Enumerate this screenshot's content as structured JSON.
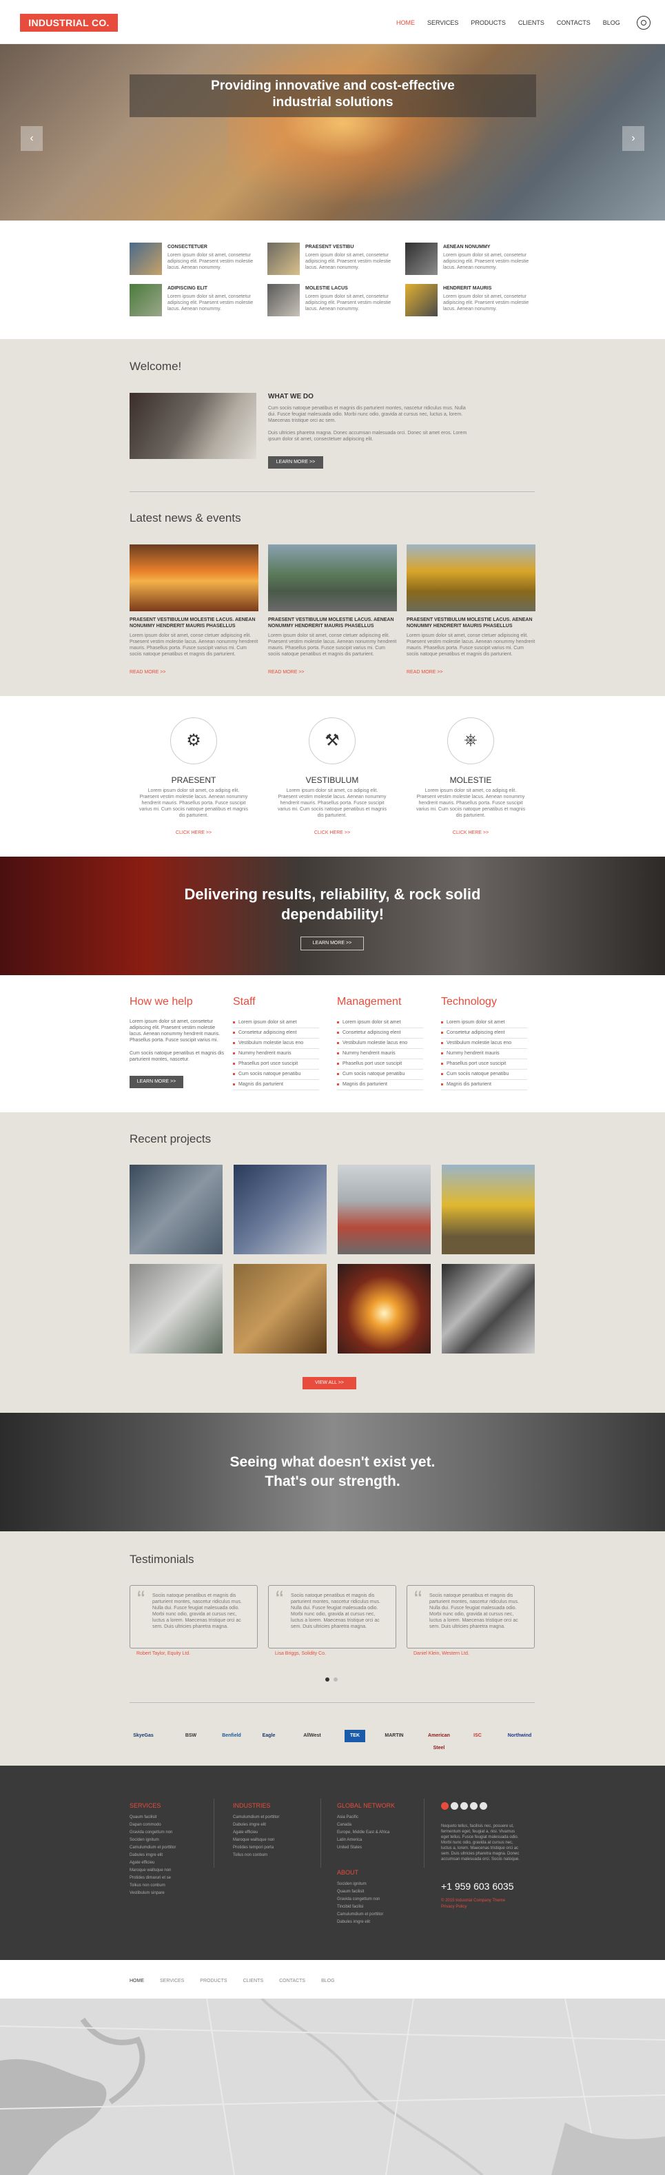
{
  "brand": {
    "logo": "INDUSTRIAL CO.",
    "accent": "#e74c3c"
  },
  "nav": {
    "items": [
      "HOME",
      "SERVICES",
      "PRODUCTS",
      "CLIENTS",
      "CONTACTS",
      "BLOG"
    ],
    "active": "HOME"
  },
  "hero": {
    "title_line1": "Providing innovative and cost-effective",
    "title_line2": "industrial solutions",
    "prev_arrow": "‹",
    "next_arrow": "›"
  },
  "features": [
    {
      "title": "CONSECTETUER",
      "text": "Lorem ipsum dolor sit amet, consetetur adipiscing elit. Praesent vestim molestie lacus. Aenean nonummy."
    },
    {
      "title": "PRAESENT VESTIBU",
      "text": "Lorem ipsum dolor sit amet, consetetur adipiscing elit. Praesent vestim molestie lacus. Aenean nonummy."
    },
    {
      "title": "AENEAN NONUMMY",
      "text": "Lorem ipsum dolor sit amet, consetetur adipiscing elit. Praesent vestim molestie lacus. Aenean nonummy."
    },
    {
      "title": "ADIPISCING ELIT",
      "text": "Lorem ipsum dolor sit amet, consetetur adipiscing elit. Praesent vestim molestie lacus. Aenean nonummy."
    },
    {
      "title": "MOLESTIE LACUS",
      "text": "Lorem ipsum dolor sit amet, consetetur adipiscing elit. Praesent vestim molestie lacus. Aenean nonummy."
    },
    {
      "title": "HENDRERIT MAURIS",
      "text": "Lorem ipsum dolor sit amet, consetetur adipiscing elit. Praesent vestim molestie lacus. Aenean nonummy."
    }
  ],
  "welcome": {
    "title": "Welcome!",
    "what_we_do": "WHAT WE DO",
    "para1": "Cum sociis natoque penatibus et magnis dis parturient montes, nascetur ridiculus mus. Nulla dui. Fusce feugiat malesuada odio. Morbi nunc odio, gravida at cursus nec, luctus a, lorem. Maecenas tristique orci ac sem.",
    "para2": "Duis ultricies pharetra magna. Donec accumsan malesuada orci. Donec sit amet eros. Lorem ipsum dolor sit amet, consectetuer adipiscing elit.",
    "button": "LEARN MORE >>"
  },
  "news": {
    "title": "Latest news & events",
    "items": [
      {
        "heading": "PRAESENT VESTIBULUM MOLESTIE LACUS. AENEAN NONUMMY HENDRERIT MAURIS PHASELLUS",
        "text": "Lorem ipsum dolor sit amet, conse ctetuer adipiscing elit. Praesent vestim molestie lacus. Aenean nonummy hendrerit mauris. Phasellus porta. Fusce suscipit varius mi. Cum sociis natoque penatibus et magnis dis parturient.",
        "more": "READ MORE >>"
      },
      {
        "heading": "PRAESENT VESTIBULUM MOLESTIE LACUS. AENEAN NONUMMY HENDRERIT MAURIS PHASELLUS",
        "text": "Lorem ipsum dolor sit amet, conse ctetuer adipiscing elit. Praesent vestim molestie lacus. Aenean nonummy hendrerit mauris. Phasellus porta. Fusce suscipit varius mi. Cum sociis natoque penatibus et magnis dis parturient.",
        "more": "READ MORE >>"
      },
      {
        "heading": "PRAESENT VESTIBULUM MOLESTIE LACUS. AENEAN NONUMMY HENDRERIT MAURIS PHASELLUS",
        "text": "Lorem ipsum dolor sit amet, conse ctetuer adipiscing elit. Praesent vestim molestie lacus. Aenean nonummy hendrerit mauris. Phasellus porta. Fusce suscipit varius mi. Cum sociis natoque penatibus et magnis dis parturient.",
        "more": "READ MORE >>"
      }
    ]
  },
  "services": [
    {
      "title": "PRAESENT",
      "icon": "worker-icon",
      "text": "Lorem ipsum dolor sit amet, co adipisg elit. Praesent vestim molestie lacus. Aenean nonummy hendrerit mauris. Phasellus porta. Fusce suscipit varius mi. Cum sociis natoque penatibus et magnis dis parturient.",
      "more": "CLICK HERE >>"
    },
    {
      "title": "VESTIBULUM",
      "icon": "oil-pump-icon",
      "text": "Lorem ipsum dolor sit amet, co adipisg elit. Praesent vestim molestie lacus. Aenean nonummy hendrerit mauris. Phasellus porta. Fusce suscipit varius mi. Cum sociis natoque penatibus et magnis dis parturient.",
      "more": "CLICK HERE >>"
    },
    {
      "title": "MOLESTIE",
      "icon": "valve-icon",
      "text": "Lorem ipsum dolor sit amet, co adipisg elit. Praesent vestim molestie lacus. Aenean nonummy hendrerit mauris. Phasellus porta. Fusce suscipit varius mi. Cum sociis natoque penatibus et magnis dis parturient.",
      "more": "CLICK HERE >>"
    }
  ],
  "banner1": {
    "line1": "Delivering results, reliability, & rock solid",
    "line2": "dependability!",
    "button": "LEARN MORE >>"
  },
  "help": {
    "title": "How we help",
    "para1": "Lorem ipsum dolor sit amet, consetetur adipiscing elit. Praesent vestim molestie lacus. Aenean nonummy hendrerit mauris. Phasellus porta. Fusce suscipit varius mi.",
    "para2": "Cum sociis natoque penatibus et magnis dis parturient montes, nascetur.",
    "button": "LEARN MORE >>",
    "columns": [
      {
        "title": "Staff",
        "items": [
          "Lorem ipsum dolor sit amet",
          "Consetetur adipiscing elent",
          "Vestibulum molestie lacus eno",
          "Nummy hendrerit mauris",
          "Phasellus port usce suscipit",
          "Cum sociis natoque penatibu",
          "Magnis dis parturient"
        ]
      },
      {
        "title": "Management",
        "items": [
          "Lorem ipsum dolor sit amet",
          "Consetetur adipiscing elent",
          "Vestibulum molestie lacus eno",
          "Nummy hendrerit mauris",
          "Phasellus port usce suscipit",
          "Cum sociis natoque penatibu",
          "Magnis dis parturient"
        ]
      },
      {
        "title": "Technology",
        "items": [
          "Lorem ipsum dolor sit amet",
          "Consetetur adipiscing elent",
          "Vestibulum molestie lacus eno",
          "Nummy hendrerit mauris",
          "Phasellus port usce suscipit",
          "Cum sociis natoque penatibu",
          "Magnis dis parturient"
        ]
      }
    ]
  },
  "projects": {
    "title": "Recent projects",
    "button": "VIEW ALL >>"
  },
  "banner2": {
    "line1": "Seeing what doesn't exist yet.",
    "line2": "That's our strength."
  },
  "testimonials": {
    "title": "Testimonials",
    "items": [
      {
        "quote": "Sociis natoque penatibus et magnis dis parturient montes, nascetur ridiculus mus. Nulla dui. Fusce feugiat malesuada odio. Morbi nunc odio, gravida at cursus nec, luctus a lorem. Maecenas tristique orci ac sem. Duis ultricies pharetra magna.",
        "author": "Robert Taylor, Equity Ltd."
      },
      {
        "quote": "Sociis natoque penatibus et magnis dis parturient montes, nascetur ridiculus mus. Nulla dui. Fusce feugiat malesuada odio. Morbi nunc odio, gravida at cursus nec, luctus a lorem. Maecenas tristique orci ac sem. Duis ultricies pharetra magna.",
        "author": "Lisa Briggs, Solidity Co."
      },
      {
        "quote": "Sociis natoque penatibus et magnis dis parturient montes, nascetur ridiculus mus. Nulla dui. Fusce feugiat malesuada odio. Morbi nunc odio, gravida at cursus nec, luctus a lorem. Maecenas tristique orci ac sem. Duis ultricies pharetra magna.",
        "author": "Daniel Klein, Western Ltd."
      }
    ]
  },
  "partners": [
    "SkyeGas",
    "BSW",
    "Benfield",
    "Eagle",
    "AllWest",
    "TEK",
    "MARTIN",
    "American Steel",
    "ISC",
    "Northwind"
  ],
  "footer": {
    "services_title": "SERVICES",
    "services": [
      "Quaum facilisit",
      "Dapan commodo",
      "Gravida congettum non",
      "Sociden ignitum",
      "Camulumdium et porttitor",
      "Dabules imgre elit",
      "Agate efficieu",
      "Maroque wallsque non",
      "Protides dimaruri et se",
      "Tolkus non conbum",
      "Vestibulum sinpare"
    ],
    "industries_title": "INDUSTRIES",
    "industries": [
      "Camulumdium et porttitor",
      "Dabules imgre elit",
      "Agate efficieu",
      "Maroque wallsque non",
      "Protides tempori porta",
      "Tollus non conbum"
    ],
    "network_title": "GLOBAL NETWORK",
    "network": [
      "Asia Pacific",
      "Canada",
      "Europe, Middle East & Africa",
      "Latin America",
      "United States"
    ],
    "about_title": "ABOUT",
    "about": [
      "Sociden ignitum",
      "Quaum facilisit",
      "Gravida congettum non",
      "Tincibid facilisi",
      "Camulumdium et porttitor",
      "Dabules imgre elit"
    ],
    "paragraph": "Nequeto tellus, facilisis nec, posuere ut, fermentum eget, feugiat a, nisi. Vivamus eget tellus. Fusce feugiat malesuada odio. Morbi nunc odio, gravida at cursus nec, luctus a, lorem. Maecenas tristique orci ac sem. Duis ultricies pharetra magna. Donec accumsan malesuada orci. Sociis natoque.",
    "phone": "+1 959 603 6035",
    "copyright": "© 2015 Industrial Company Theme",
    "privacy": "Privacy Policy"
  },
  "bottom_nav": [
    "HOME",
    "SERVICES",
    "PRODUCTS",
    "CLIENTS",
    "CONTACTS",
    "BLOG"
  ]
}
